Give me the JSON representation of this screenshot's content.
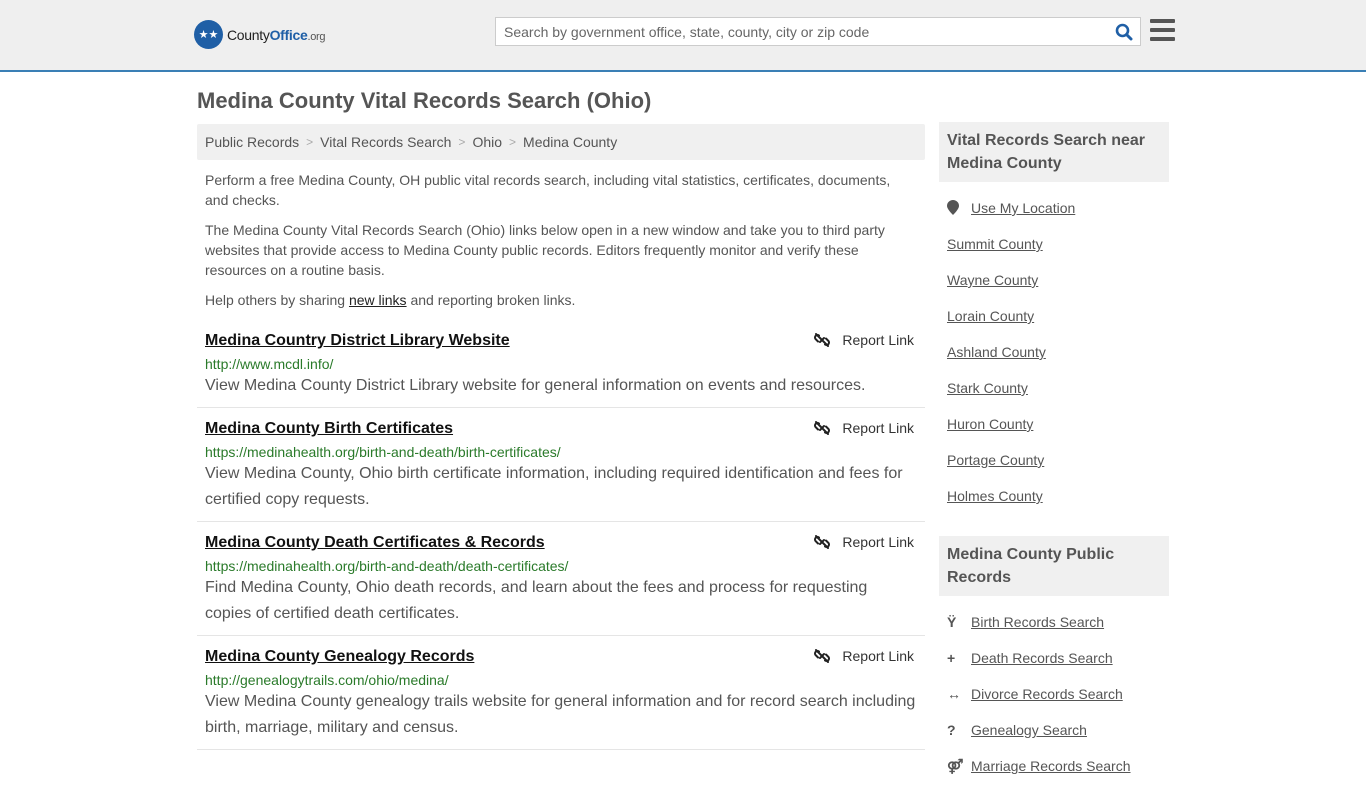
{
  "header": {
    "logo": {
      "county": "County",
      "office": "Office",
      "org": ".org"
    },
    "search_placeholder": "Search by government office, state, county, city or zip code"
  },
  "page_title": "Medina County Vital Records Search (Ohio)",
  "breadcrumbs": [
    "Public Records",
    "Vital Records Search",
    "Ohio",
    "Medina County"
  ],
  "intro": {
    "p1": "Perform a free Medina County, OH public vital records search, including vital statistics, certificates, documents, and checks.",
    "p2": "The Medina County Vital Records Search (Ohio) links below open in a new window and take you to third party websites that provide access to Medina County public records. Editors frequently monitor and verify these resources on a routine basis.",
    "p3_before": "Help others by sharing ",
    "p3_link": "new links",
    "p3_after": " and reporting broken links."
  },
  "report_label": "Report Link",
  "results": [
    {
      "title": "Medina Country District Library Website",
      "url": "http://www.mcdl.info/",
      "desc": "View Medina County District Library website for general information on events and resources."
    },
    {
      "title": "Medina County Birth Certificates",
      "url": "https://medinahealth.org/birth-and-death/birth-certificates/",
      "desc": "View Medina County, Ohio birth certificate information, including required identification and fees for certified copy requests."
    },
    {
      "title": "Medina County Death Certificates & Records",
      "url": "https://medinahealth.org/birth-and-death/death-certificates/",
      "desc": "Find Medina County, Ohio death records, and learn about the fees and process for requesting copies of certified death certificates."
    },
    {
      "title": "Medina County Genealogy Records",
      "url": "http://genealogytrails.com/ohio/medina/",
      "desc": "View Medina County genealogy trails website for general information and for record search including birth, marriage, military and census."
    }
  ],
  "sidebar": {
    "nearby_title": "Vital Records Search near Medina County",
    "use_location": "Use My Location",
    "nearby": [
      "Summit County",
      "Wayne County",
      "Lorain County",
      "Ashland County",
      "Stark County",
      "Huron County",
      "Portage County",
      "Holmes County"
    ],
    "public_title": "Medina County Public Records",
    "public": [
      {
        "icon": "baby-icon",
        "glyph": "Ÿ",
        "label": "Birth Records Search"
      },
      {
        "icon": "plus-icon",
        "glyph": "+",
        "label": "Death Records Search"
      },
      {
        "icon": "arrows-horizontal-icon",
        "glyph": "↔",
        "label": "Divorce Records Search"
      },
      {
        "icon": "question-icon",
        "glyph": "?",
        "label": "Genealogy Search"
      },
      {
        "icon": "rings-icon",
        "glyph": "⚤",
        "label": "Marriage Records Search"
      }
    ]
  }
}
